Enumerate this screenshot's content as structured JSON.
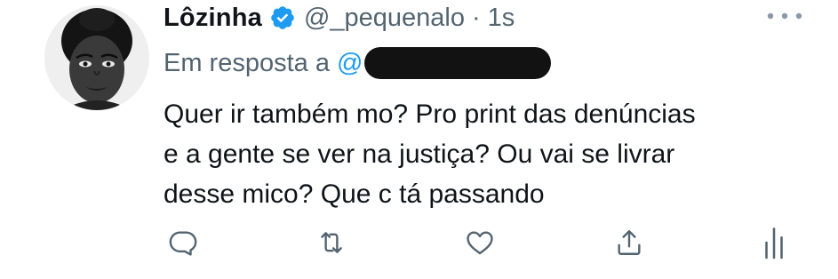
{
  "author": {
    "display_name": "Lôzinha",
    "handle": "@_pequenalo",
    "separator": "·",
    "time": "1s",
    "verified": true
  },
  "reply": {
    "prefix": "Em resposta a",
    "at": "@"
  },
  "tweet": {
    "lines": [
      "Quer ir também mo? Pro print das denúncias",
      "e a gente se ver na justiça? Ou vai se livrar",
      "desse mico? Que c tá passando"
    ]
  },
  "icons": {
    "verified": "verified-badge-icon",
    "more": "more-options-icon",
    "reply": "reply-icon",
    "retweet": "retweet-icon",
    "like": "like-icon",
    "share": "share-icon",
    "analytics": "analytics-icon"
  },
  "colors": {
    "verified": "#1d9bf0",
    "mention": "#1d9bf0",
    "secondary_text": "#536471",
    "icon": "#536471"
  }
}
